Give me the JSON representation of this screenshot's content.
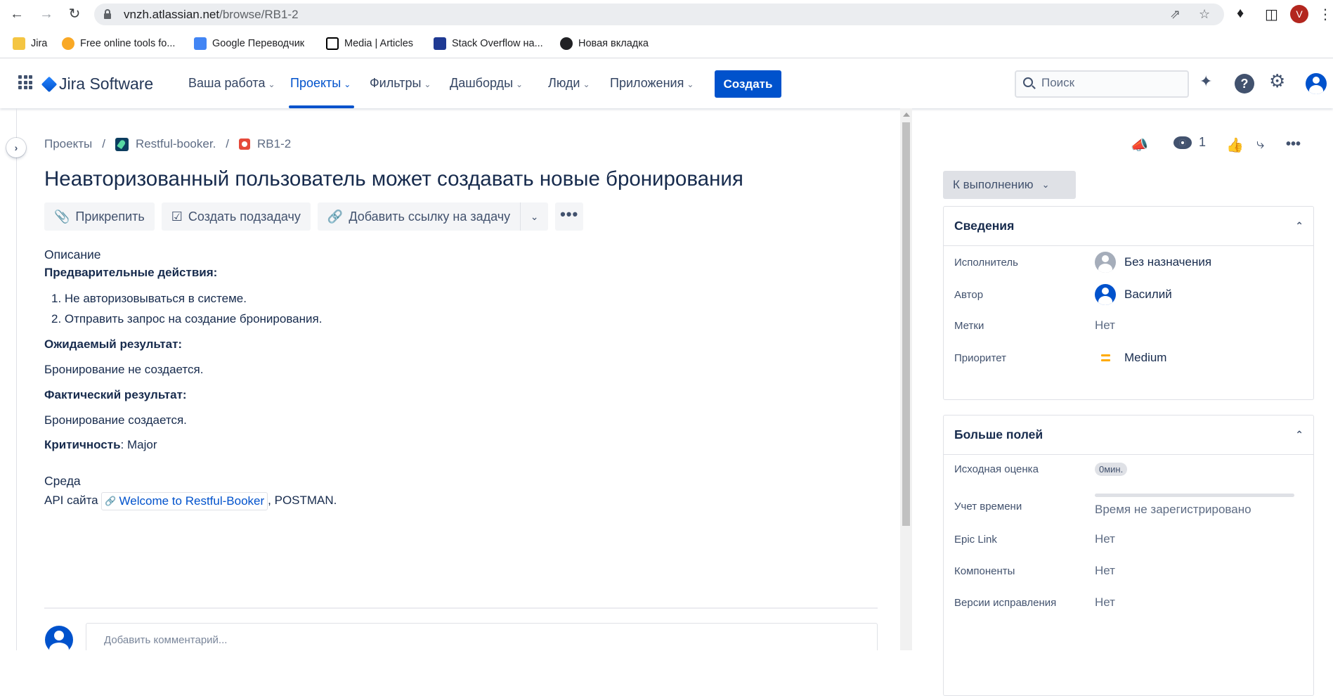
{
  "browser": {
    "url_host": "vnzh.atlassian.net",
    "url_path": "/browse/RB1-2",
    "profile_initial": "V",
    "bookmarks": [
      {
        "label": "Jira",
        "icon": "folder-icon",
        "color": "#f4c542"
      },
      {
        "label": "Free online tools fo...",
        "icon": "smiley-icon",
        "color": "#f9a825"
      },
      {
        "label": "Google Переводчик",
        "icon": "translate-icon",
        "color": "#4285f4"
      },
      {
        "label": "Media | Articles",
        "icon": "notion-icon",
        "color": "#000000"
      },
      {
        "label": "Stack Overflow на...",
        "icon": "stackoverflow-icon",
        "color": "#1f3a93"
      },
      {
        "label": "Новая вкладка",
        "icon": "globe-icon",
        "color": "#202124"
      }
    ]
  },
  "jira_nav": {
    "product": "Jira Software",
    "items": [
      {
        "label": "Ваша работа"
      },
      {
        "label": "Проекты"
      },
      {
        "label": "Фильтры"
      },
      {
        "label": "Дашборды"
      },
      {
        "label": "Люди"
      },
      {
        "label": "Приложения"
      }
    ],
    "create_label": "Создать",
    "search_placeholder": "Поиск"
  },
  "breadcrumbs": {
    "root": "Проекты",
    "project": "Restful-booker.",
    "issue_key": "RB1-2"
  },
  "issue": {
    "title": "Неавторизованный пользователь может создавать новые бронирования",
    "actions": {
      "attach": "Прикрепить",
      "subtask": "Создать подзадачу",
      "link": "Добавить ссылку на задачу"
    },
    "description_label": "Описание",
    "preconditions_label": "Предварительные действия:",
    "steps": [
      "1. Не авторизовываться в системе.",
      "2.  Отправить запрос на создание бронирования."
    ],
    "expected_label": "Ожидаемый  результат:",
    "expected": "Бронирование не создается.",
    "actual_label": "Фактический результат:",
    "actual": "Бронирование создается.",
    "severity_label": "Критичность",
    "severity_value": ": Major",
    "environment_label": "Среда",
    "env_prefix": "API сайта",
    "env_link": "Welcome to Restful-Booker",
    "env_suffix": ", POSTMAN.",
    "comment_placeholder": "Добавить комментарий..."
  },
  "sidebar": {
    "watchers_count": "1",
    "status": "К выполнению",
    "details": {
      "title": "Сведения",
      "fields": [
        {
          "label": "Исполнитель",
          "value": "Без назначения"
        },
        {
          "label": "Автор",
          "value": "Василий"
        },
        {
          "label": "Метки",
          "value": "Нет"
        },
        {
          "label": "Приоритет",
          "value": "Medium"
        }
      ]
    },
    "more": {
      "title": "Больше полей",
      "fields": [
        {
          "label": "Исходная оценка",
          "value": "0мин."
        },
        {
          "label": "Учет времени",
          "value": "Время не зарегистрировано"
        },
        {
          "label": "Epic Link",
          "value": "Нет"
        },
        {
          "label": "Компоненты",
          "value": "Нет"
        },
        {
          "label": "Версии исправления",
          "value": "Нет"
        }
      ]
    }
  },
  "colors": {
    "primary": "#0052cc",
    "priority_medium": "#ffab00",
    "bug": "#e5493a"
  }
}
